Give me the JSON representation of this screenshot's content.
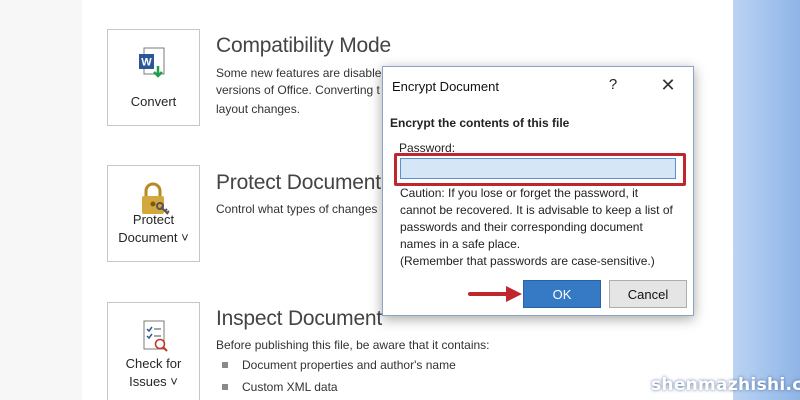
{
  "sections": {
    "compatibility": {
      "button_label": "Convert",
      "title": "Compatibility Mode",
      "desc_line1": "Some new features are disabled",
      "desc_line2": "versions of Office. Converting t",
      "desc_line3": "layout changes."
    },
    "protect": {
      "button_label_line1": "Protect",
      "button_label_line2": "Document ˅",
      "title": "Protect Document",
      "desc_line1": "Control what types of changes"
    },
    "inspect": {
      "button_label_line1": "Check for",
      "button_label_line2": "Issues ˅",
      "title": "Inspect Document",
      "desc_line1": "Before publishing this file, be aware that it contains:",
      "bullets": [
        "Document properties and author's name",
        "Custom XML data"
      ]
    }
  },
  "dialog": {
    "title": "Encrypt Document",
    "help_glyph": "?",
    "close_glyph": "✕",
    "heading": "Encrypt the contents of this file",
    "password_label": "Password:",
    "password_value": "",
    "caution_line1": "Caution: If you lose or forget the password, it",
    "caution_line2": "cannot be recovered. It is advisable to keep a list of",
    "caution_line3": "passwords and their corresponding document",
    "caution_line4": "names in a safe place.",
    "caution_line5": "(Remember that passwords are case-sensitive.)",
    "ok_label": "OK",
    "cancel_label": "Cancel"
  },
  "watermark": "shenmazhishi.com",
  "colors": {
    "highlight": "#c0272d",
    "ok_button": "#3679c4",
    "word_blue": "#2b579a",
    "lock_gold": "#d4a73c"
  },
  "icons": {
    "convert": "word-convert-icon",
    "protect": "lock-key-icon",
    "inspect": "checklist-icon"
  }
}
